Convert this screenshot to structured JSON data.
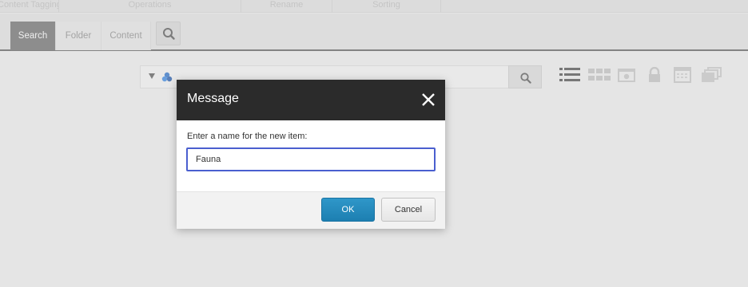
{
  "ribbon": {
    "groups": [
      "Content Tagging",
      "Operations",
      "Rename",
      "Sorting"
    ]
  },
  "tabs": {
    "items": [
      {
        "label": "Search",
        "active": true
      },
      {
        "label": "Folder",
        "active": false
      },
      {
        "label": "Content",
        "active": false
      }
    ],
    "search_button_icon": "search-icon"
  },
  "search": {
    "dropdown_icon": "triangle-down-icon",
    "source_icon": "database-icon",
    "query": "",
    "go_icon": "search-icon"
  },
  "view_icons": [
    "list-view-icon",
    "grid-view-icon",
    "preview-icon",
    "lock-icon",
    "calendar-icon",
    "stack-icon"
  ],
  "dialog": {
    "title": "Message",
    "close_icon": "close-icon",
    "prompt": "Enter a name for the new item:",
    "input_value": "Fauna",
    "ok_label": "OK",
    "cancel_label": "Cancel"
  },
  "colors": {
    "dialog_header": "#2b2b2b",
    "ok_button": "#1f86b8",
    "input_focus_border": "#4a5fcf",
    "active_tab": "#6c6c6c"
  }
}
